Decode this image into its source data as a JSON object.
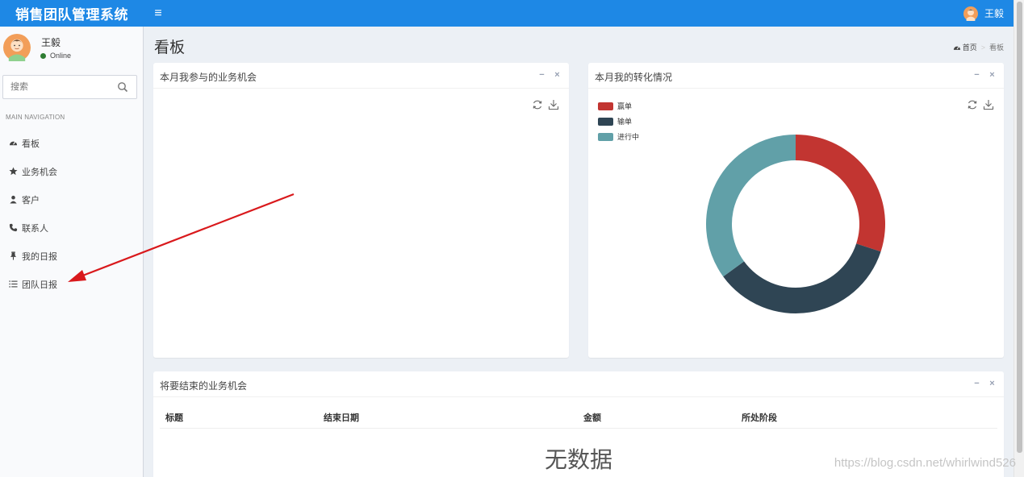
{
  "app": {
    "title": "销售团队管理系统",
    "menu_toggle": "≡"
  },
  "header": {
    "user_name": "王毅"
  },
  "sidebar": {
    "user_name": "王毅",
    "status": "Online",
    "search_placeholder": "搜索",
    "nav_header": "MAIN NAVIGATION",
    "items": [
      {
        "label": "看板",
        "icon": "dashboard-icon"
      },
      {
        "label": "业务机会",
        "icon": "star-icon"
      },
      {
        "label": "客户",
        "icon": "users-icon"
      },
      {
        "label": "联系人",
        "icon": "phone-icon"
      },
      {
        "label": "我的日报",
        "icon": "pin-icon"
      },
      {
        "label": "团队日报",
        "icon": "list-icon"
      }
    ]
  },
  "page": {
    "title": "看板",
    "breadcrumb": {
      "home": "首页",
      "current": "看板"
    }
  },
  "boxes": {
    "opportunities": {
      "title": "本月我参与的业务机会"
    },
    "conversion": {
      "title": "本月我的转化情况"
    },
    "ending": {
      "title": "将要结束的业务机会",
      "columns": [
        "标题",
        "结束日期",
        "金额",
        "所处阶段"
      ],
      "empty_text": "无数据"
    }
  },
  "chart_data": {
    "type": "pie",
    "title": "",
    "legend_position": "top-left",
    "series": [
      {
        "name": "赢单",
        "value": 30,
        "color": "#c23531"
      },
      {
        "name": "输单",
        "value": 35,
        "color": "#2f4554"
      },
      {
        "name": "进行中",
        "value": 35,
        "color": "#61a0a8"
      }
    ]
  },
  "watermark": "https://blog.csdn.net/whirlwind526"
}
